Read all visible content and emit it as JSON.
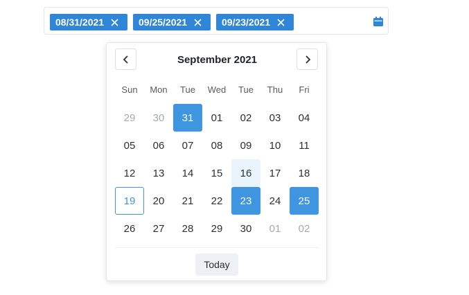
{
  "field": {
    "chips": [
      {
        "label": "08/31/2021"
      },
      {
        "label": "09/25/2021"
      },
      {
        "label": "09/23/2021"
      }
    ],
    "icon": "calendar-icon"
  },
  "picker": {
    "month_label": "September 2021",
    "weekdays": [
      "Sun",
      "Mon",
      "Tue",
      "Wed",
      "Tue",
      "Thu",
      "Fri"
    ],
    "days": [
      {
        "label": "29",
        "state": "muted"
      },
      {
        "label": "30",
        "state": "muted"
      },
      {
        "label": "31",
        "state": "selected"
      },
      {
        "label": "01",
        "state": ""
      },
      {
        "label": "02",
        "state": ""
      },
      {
        "label": "03",
        "state": ""
      },
      {
        "label": "04",
        "state": ""
      },
      {
        "label": "05",
        "state": ""
      },
      {
        "label": "06",
        "state": ""
      },
      {
        "label": "07",
        "state": ""
      },
      {
        "label": "08",
        "state": ""
      },
      {
        "label": "09",
        "state": ""
      },
      {
        "label": "10",
        "state": ""
      },
      {
        "label": "11",
        "state": ""
      },
      {
        "label": "12",
        "state": ""
      },
      {
        "label": "13",
        "state": ""
      },
      {
        "label": "14",
        "state": ""
      },
      {
        "label": "15",
        "state": ""
      },
      {
        "label": "16",
        "state": "hover"
      },
      {
        "label": "17",
        "state": ""
      },
      {
        "label": "18",
        "state": ""
      },
      {
        "label": "19",
        "state": "today"
      },
      {
        "label": "20",
        "state": ""
      },
      {
        "label": "21",
        "state": ""
      },
      {
        "label": "22",
        "state": ""
      },
      {
        "label": "23",
        "state": "selected"
      },
      {
        "label": "24",
        "state": ""
      },
      {
        "label": "25",
        "state": "selected"
      },
      {
        "label": "26",
        "state": ""
      },
      {
        "label": "27",
        "state": ""
      },
      {
        "label": "28",
        "state": ""
      },
      {
        "label": "29",
        "state": ""
      },
      {
        "label": "30",
        "state": ""
      },
      {
        "label": "01",
        "state": "muted"
      },
      {
        "label": "02",
        "state": "muted"
      }
    ],
    "today_label": "Today"
  },
  "colors": {
    "accent": "#3f95e0",
    "chip": "#2f86d9",
    "muted_text": "#a3a9b1",
    "hover_bg": "#eaf4fd"
  }
}
